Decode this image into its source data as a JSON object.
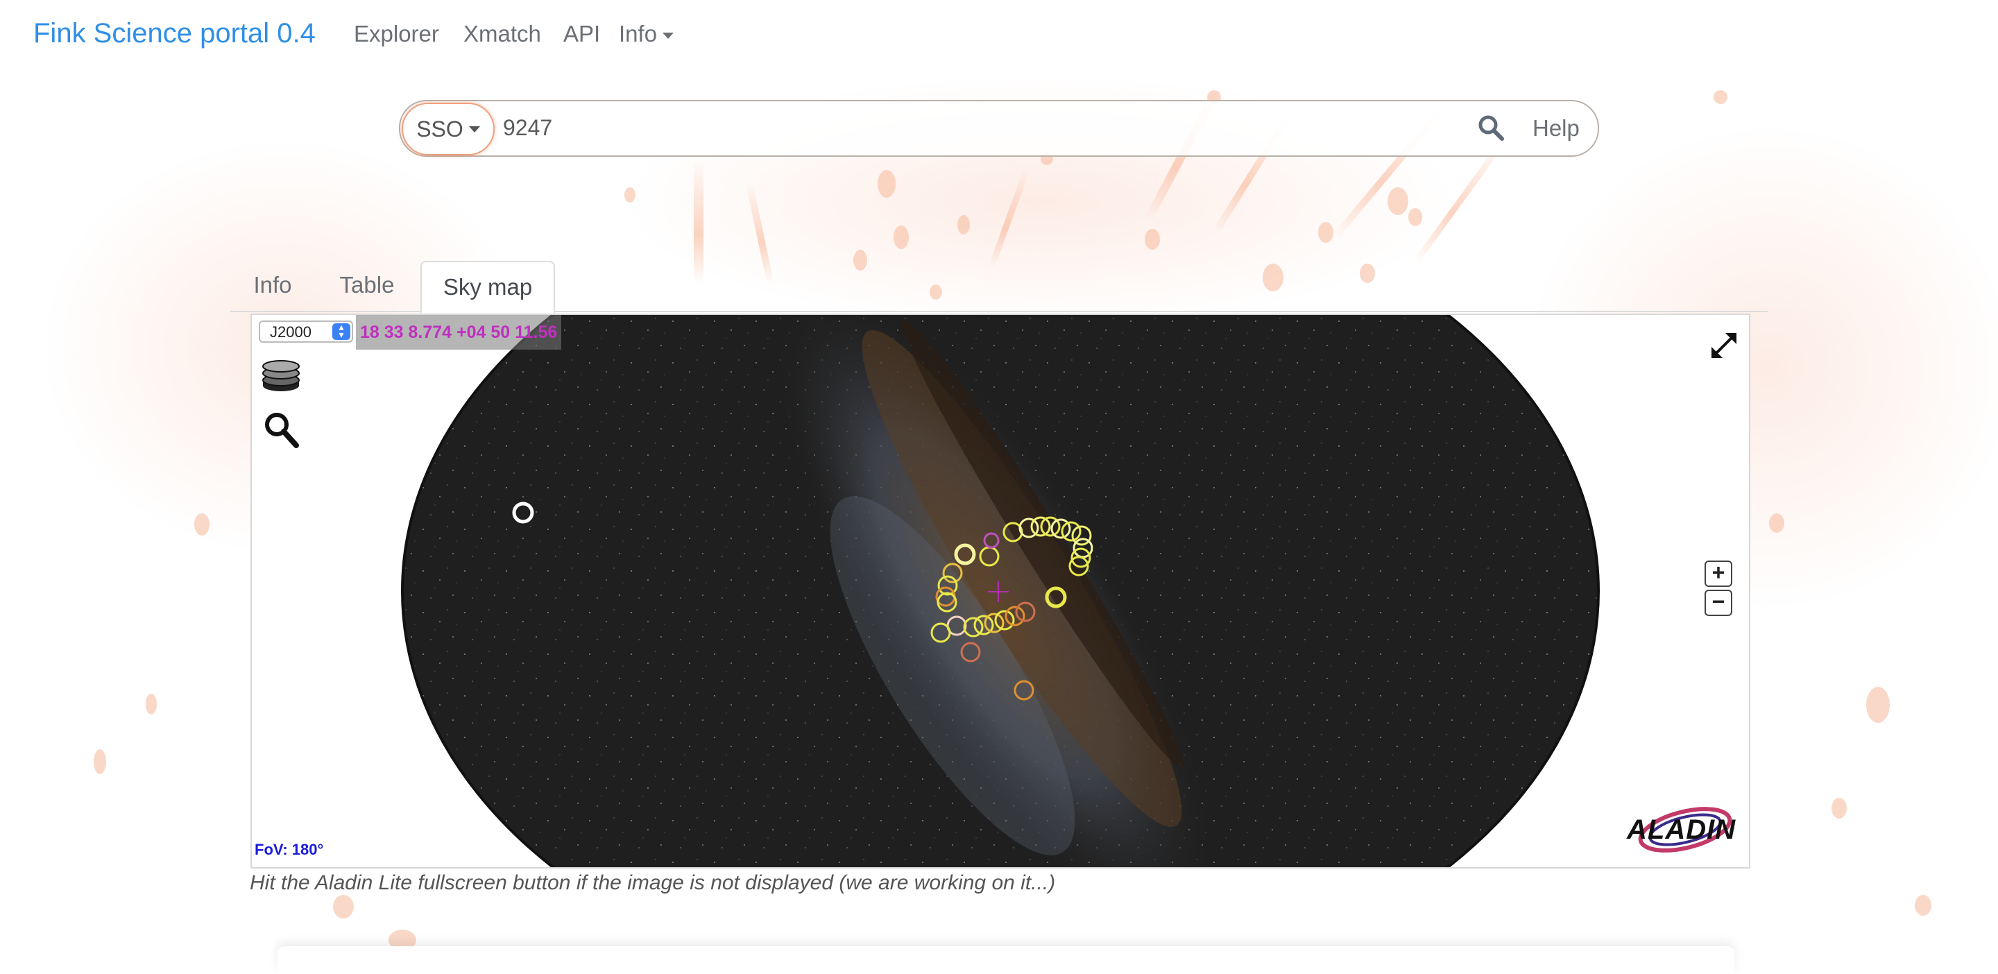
{
  "navbar": {
    "brand": "Fink Science portal 0.4",
    "links": [
      "Explorer",
      "Xmatch",
      "API"
    ],
    "info_menu": "Info"
  },
  "search": {
    "type_label": "SSO",
    "value": "9247",
    "search_icon": "search-icon",
    "help_label": "Help"
  },
  "tabs": [
    {
      "label": "Info",
      "active": false
    },
    {
      "label": "Table",
      "active": false
    },
    {
      "label": "Sky map",
      "active": true
    }
  ],
  "skymap": {
    "frame": "J2000",
    "coordinates": "18 33 8.774 +04 50 11.56",
    "fov": "FoV: 180°",
    "logo": "ALADIN",
    "zoom_in": "+",
    "zoom_out": "−",
    "icons": [
      "layers-icon",
      "search-icon",
      "fullscreen-icon",
      "aladin-logo"
    ]
  },
  "note": "Hit the Aladin Lite fullscreen button if the image is not displayed (we are working on it...)",
  "colors": {
    "brand": "#2f8fe6",
    "accent": "#f0a07e",
    "coords": "#c030c0",
    "fov": "#1b1bdc"
  }
}
